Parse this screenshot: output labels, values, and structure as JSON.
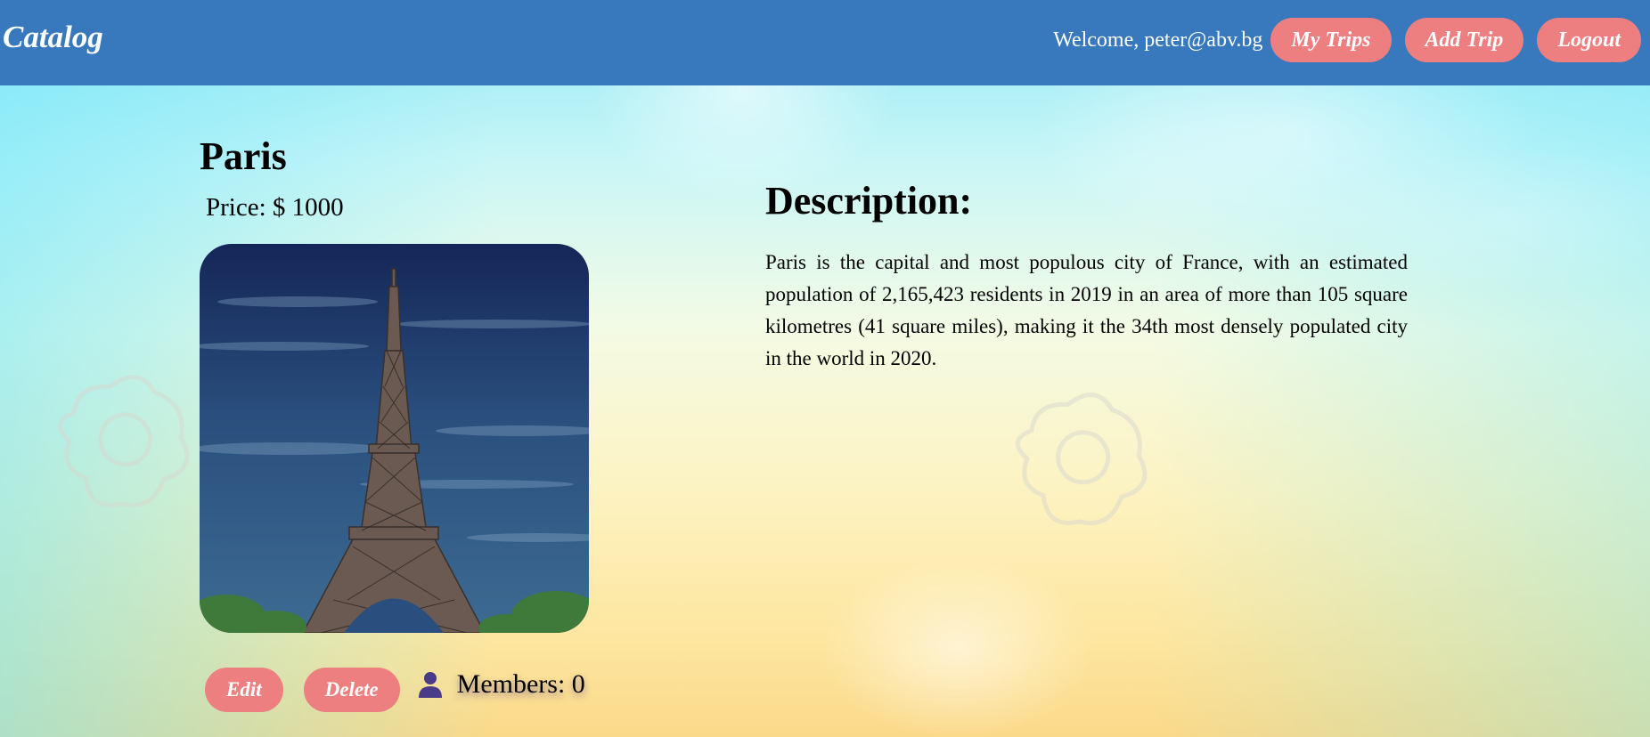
{
  "header": {
    "logo": "Catalog",
    "welcome": "Welcome, peter@abv.bg",
    "nav": {
      "my_trips": "My Trips",
      "add_trip": "Add Trip",
      "logout": "Logout"
    },
    "colors": {
      "bar": "#3878bd",
      "button": "#ee7f80"
    }
  },
  "trip": {
    "title": "Paris",
    "price": "Price: $ 1000",
    "image_icon": "eiffel-tower-photo",
    "actions": {
      "edit": "Edit",
      "delete": "Delete"
    },
    "members_icon": "user-icon",
    "members": "Members: 0"
  },
  "description": {
    "heading": "Description:",
    "text": "Paris is the capital and most populous city of France, with an estimated population of 2,165,423 residents in 2019 in an area of more than 105 square kilometres (41 square miles), making it the 34th most densely populated city in the world in 2020."
  }
}
